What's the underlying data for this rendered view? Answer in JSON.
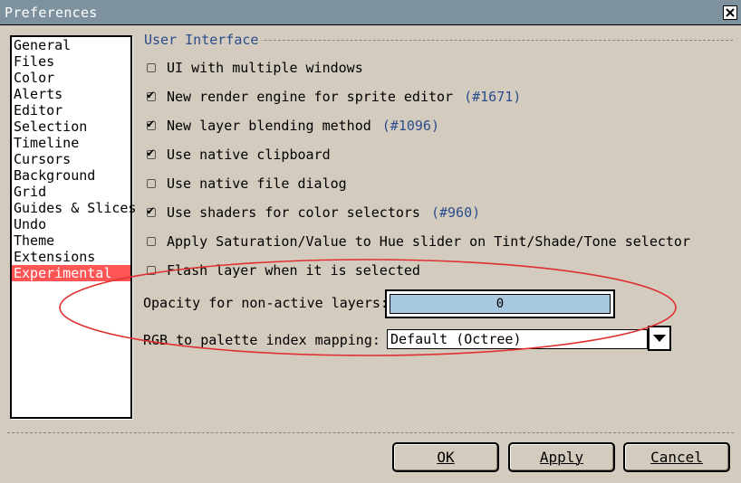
{
  "window": {
    "title": "Preferences"
  },
  "sidebar": {
    "items": [
      {
        "label": "General"
      },
      {
        "label": "Files"
      },
      {
        "label": "Color"
      },
      {
        "label": "Alerts"
      },
      {
        "label": "Editor"
      },
      {
        "label": "Selection"
      },
      {
        "label": "Timeline"
      },
      {
        "label": "Cursors"
      },
      {
        "label": "Background"
      },
      {
        "label": "Grid"
      },
      {
        "label": "Guides & Slices"
      },
      {
        "label": "Undo"
      },
      {
        "label": "Theme"
      },
      {
        "label": "Extensions"
      },
      {
        "label": "Experimental"
      }
    ],
    "selected": "Experimental"
  },
  "ui_group": {
    "label": "User Interface"
  },
  "options": [
    {
      "label": "UI with multiple windows",
      "checked": false,
      "issue": ""
    },
    {
      "label": "New render engine for sprite editor",
      "checked": true,
      "issue": "(#1671)"
    },
    {
      "label": "New layer blending method",
      "checked": true,
      "issue": "(#1096)"
    },
    {
      "label": "Use native clipboard",
      "checked": true,
      "issue": ""
    },
    {
      "label": "Use native file dialog",
      "checked": false,
      "issue": ""
    },
    {
      "label": "Use shaders for color selectors",
      "checked": true,
      "issue": "(#960)"
    },
    {
      "label": "Apply Saturation/Value to Hue slider on Tint/Shade/Tone selector",
      "checked": false,
      "issue": ""
    },
    {
      "label": "Flash layer when it is selected",
      "checked": false,
      "issue": ""
    }
  ],
  "opacity": {
    "label": "Opacity for non-active layers:",
    "value": "0"
  },
  "rgb_mapping": {
    "label": "RGB to palette index mapping:",
    "value": "Default (Octree)"
  },
  "buttons": {
    "ok": "OK",
    "apply": "Apply",
    "cancel": "Cancel"
  },
  "colors": {
    "titlebar": "#7d929e",
    "selection": "#ff5555",
    "annotation": "#e03030",
    "link": "#2c4c8c"
  }
}
